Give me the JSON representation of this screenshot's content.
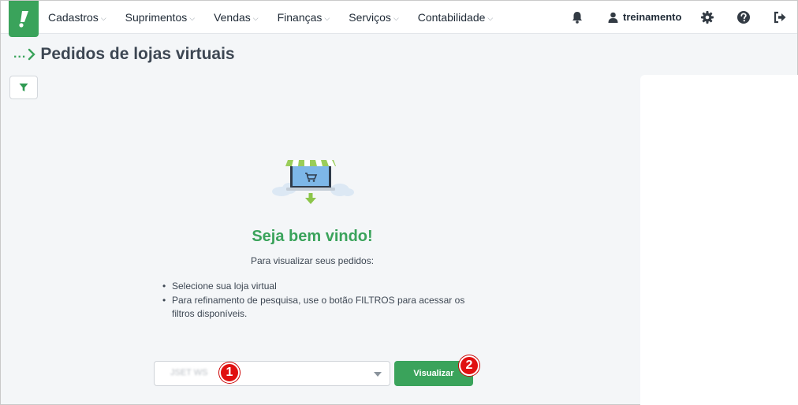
{
  "nav": {
    "menu": [
      {
        "label": "Cadastros"
      },
      {
        "label": "Suprimentos"
      },
      {
        "label": "Vendas"
      },
      {
        "label": "Finanças"
      },
      {
        "label": "Serviços"
      },
      {
        "label": "Contabilidade"
      }
    ],
    "chevron": "⌵",
    "user": "treinamento",
    "icons": [
      "bell-icon",
      "user-icon",
      "gear-icon",
      "help-icon",
      "logout-icon"
    ],
    "brand_color": "#3aa35b"
  },
  "breadcrumb": {
    "ellipsis": "...",
    "title": "Pedidos de lojas virtuais"
  },
  "main": {
    "welcome": "Seja bem vindo!",
    "subtitle": "Para visualizar seus pedidos:",
    "instructions": [
      "Selecione sua loja virtual",
      "Para refinamento de pesquisa, use o botão FILTROS para acessar os filtros disponíveis."
    ],
    "store_select_value": "JSET WS",
    "view_button": "Visualizar",
    "markers": [
      "1",
      "2"
    ]
  }
}
